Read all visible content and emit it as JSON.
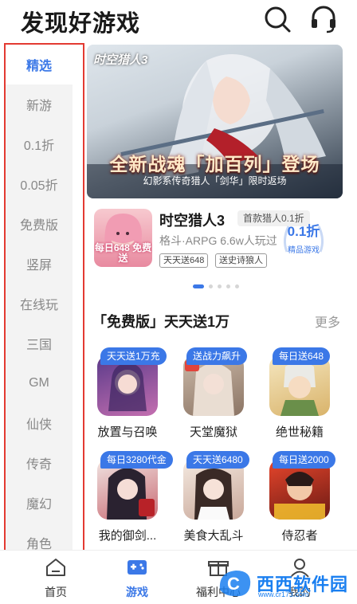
{
  "header": {
    "title": "发现好游戏",
    "search_icon": "search-icon",
    "service_icon": "headset-icon"
  },
  "sidebar": {
    "items": [
      {
        "label": "精选",
        "active": true
      },
      {
        "label": "新游"
      },
      {
        "label": "0.1折"
      },
      {
        "label": "0.05折"
      },
      {
        "label": "免费版"
      },
      {
        "label": "竖屏"
      },
      {
        "label": "在线玩"
      },
      {
        "label": "三国"
      },
      {
        "label": "GM"
      },
      {
        "label": "仙侠"
      },
      {
        "label": "传奇"
      },
      {
        "label": "魔幻"
      },
      {
        "label": "角色"
      }
    ]
  },
  "banner": {
    "logo": "时空猎人3",
    "headline": "全新战魂「加百列」登场",
    "subline": "幻影系传奇猎人「剑华」限时返场"
  },
  "featured": {
    "thumb_label": "每日648 免费送",
    "name": "时空猎人3",
    "first_discount_tag": "首款猎人0.1折",
    "meta": "格斗·ARPG  6.6w人玩过",
    "pills": [
      "天天送648",
      "送史诗狼人"
    ],
    "badge_value": "0.1折",
    "badge_label": "精品游戏"
  },
  "carousel": {
    "total": 5,
    "active_index": 0
  },
  "section": {
    "title": "「免费版」天天送1万",
    "more": "更多"
  },
  "games": [
    {
      "tag": "天天送1万充",
      "name": "放置与召唤"
    },
    {
      "tag": "送战力飙升",
      "name": "天堂魔狱"
    },
    {
      "tag": "每日送648",
      "name": "绝世秘籍"
    },
    {
      "tag": "每日3280代金",
      "name": "我的御剑..."
    },
    {
      "tag": "天天送6480",
      "name": "美食大乱斗"
    },
    {
      "tag": "每日送2000",
      "name": "侍忍者"
    }
  ],
  "bottom_nav": [
    {
      "label": "首页",
      "icon": "home-icon"
    },
    {
      "label": "游戏",
      "icon": "gamepad-icon",
      "active": true
    },
    {
      "label": "福利中心",
      "icon": "gift-icon"
    },
    {
      "label": "我的",
      "icon": "user-icon"
    }
  ],
  "watermark": {
    "text": "西西软件园",
    "sub": "www.cr173.com"
  },
  "colors": {
    "accent": "#3b78e7",
    "sidebar_border": "#e33a32",
    "sidebar_bg": "#f3f3f3"
  }
}
